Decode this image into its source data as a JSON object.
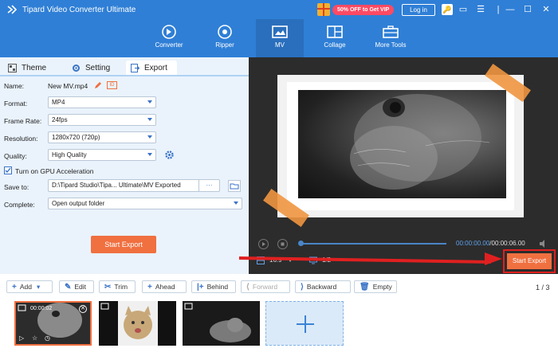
{
  "window": {
    "title": "Tipard Video Converter Ultimate",
    "promo": "50% OFF to Get VIP",
    "login": "Log in",
    "controls": [
      "☰",
      "▭",
      "—",
      "☐",
      "✕"
    ]
  },
  "nav": {
    "items": [
      {
        "label": "Converter",
        "icon": "converter-icon"
      },
      {
        "label": "Ripper",
        "icon": "ripper-icon"
      },
      {
        "label": "MV",
        "icon": "mv-icon",
        "active": true
      },
      {
        "label": "Collage",
        "icon": "collage-icon"
      },
      {
        "label": "More Tools",
        "icon": "toolbox-icon"
      }
    ]
  },
  "tabs": [
    {
      "label": "Theme"
    },
    {
      "label": "Setting"
    },
    {
      "label": "Export",
      "active": true
    }
  ],
  "export": {
    "name_label": "Name:",
    "name_value": "New MV.mp4",
    "format_label": "Format:",
    "format_value": "MP4",
    "framerate_label": "Frame Rate:",
    "framerate_value": "24fps",
    "resolution_label": "Resolution:",
    "resolution_value": "1280x720 (720p)",
    "quality_label": "Quality:",
    "quality_value": "High Quality",
    "gpu_label": "Turn on GPU Acceleration",
    "gpu_checked": true,
    "saveto_label": "Save to:",
    "saveto_value": "D:\\Tipard Studio\\Tipa... Ultimate\\MV Exported",
    "saveto_dots": "···",
    "complete_label": "Complete:",
    "complete_value": "Open output folder",
    "start_export": "Start Export"
  },
  "player": {
    "time_current": "00:00:00.00",
    "time_total": "/00:00:06.00",
    "aspect": "16:9",
    "ratio": "1/2",
    "start_export": "Start Export",
    "progress": 0
  },
  "toolbar": {
    "add": "Add",
    "edit": "Edit",
    "trim": "Trim",
    "ahead": "Ahead",
    "behind": "Behind",
    "forward": "Forward",
    "backward": "Backward",
    "empty": "Empty",
    "page_count": "1 / 3"
  },
  "timeline": {
    "clips": [
      {
        "time": "00:00:02",
        "selected": true
      },
      {
        "time": "",
        "selected": false
      },
      {
        "time": "",
        "selected": false
      }
    ]
  },
  "colors": {
    "brand_blue": "#2f7fd6",
    "accent_orange": "#f07040",
    "highlight_red": "#e02020"
  }
}
